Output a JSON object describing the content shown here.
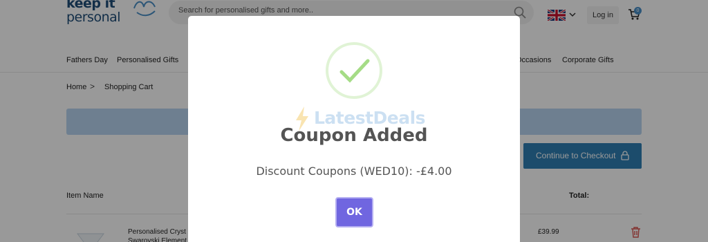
{
  "header": {
    "logo_line1": "keep it",
    "logo_line2": "personal",
    "search_placeholder": "Search for personalised gifts and more..",
    "login_label": "Log in",
    "cart_count": "0"
  },
  "nav": {
    "items": [
      "Fathers Day",
      "Personalised Gifts",
      "Occasions",
      "Corporate Gifts"
    ]
  },
  "breadcrumb": {
    "home": "Home",
    "separator": ">",
    "current": "Shopping Cart"
  },
  "cart": {
    "checkout_label": "Continue to Checkout",
    "col_item": "Item Name",
    "col_total": "Total:",
    "items": [
      {
        "name": "Personalised Cryst Swarovski Element",
        "price": "£39.99"
      }
    ]
  },
  "modal": {
    "watermark": "LatestDeals",
    "title": "Coupon Added",
    "text": "Discount Coupons (WED10): -£4.00",
    "ok_label": "OK"
  },
  "colors": {
    "accent": "#7066e0",
    "success": "#a5dc86",
    "checkout": "#2f7fb5",
    "brand": "#1f4e79"
  }
}
